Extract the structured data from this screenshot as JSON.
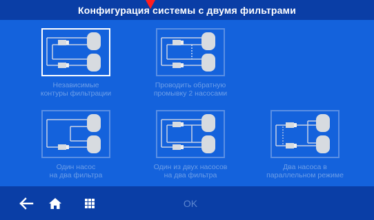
{
  "header": {
    "title": "Конфигурация системы с двумя фильтрами"
  },
  "options": [
    {
      "line1": "Независимые",
      "line2": "контуры фильтрации",
      "selected": true,
      "diagram": "independent"
    },
    {
      "line1": "Проводить обратную",
      "line2": "промывку 2 насосами",
      "selected": false,
      "diagram": "backwash"
    },
    {
      "line1": "Один насос",
      "line2": "на два фильтра",
      "selected": false,
      "diagram": "one-pump"
    },
    {
      "line1": "Один из двух насосов",
      "line2": "на два фильтра",
      "selected": false,
      "diagram": "one-of-two"
    },
    {
      "line1": "Два насоса в",
      "line2": "параллельном режиме",
      "selected": false,
      "diagram": "parallel"
    }
  ],
  "footer": {
    "ok_label": "OK",
    "icons": [
      "back-arrow-icon",
      "home-icon",
      "grid-menu-icon"
    ]
  },
  "colors": {
    "background": "#1462dc",
    "bar": "#0a3ea6",
    "frame": "#5a8fe4",
    "caption": "#6e9fe8",
    "alarm": "#ff1e1e"
  }
}
